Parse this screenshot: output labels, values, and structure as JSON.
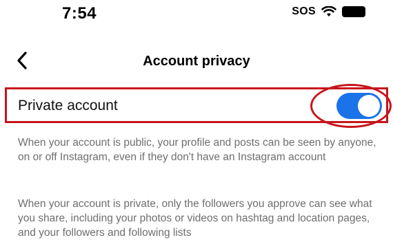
{
  "status_bar": {
    "time": "7:54",
    "sos": "SOS",
    "icons": [
      "wifi-icon",
      "battery-icon"
    ]
  },
  "nav": {
    "title": "Account privacy",
    "back_icon": "chevron-left-icon"
  },
  "private_account": {
    "label": "Private account",
    "toggle_on": true,
    "toggle_color": "#1a73e8",
    "highlight_color": "#c8141c"
  },
  "descriptions": {
    "public": "When your account is public, your profile and posts can be seen by anyone, on or off Instagram, even if they don't have an Instagram account",
    "private": "When your account is private, only the followers you approve can see what you share, including your photos or videos on hashtag and location pages, and your followers and following lists"
  }
}
